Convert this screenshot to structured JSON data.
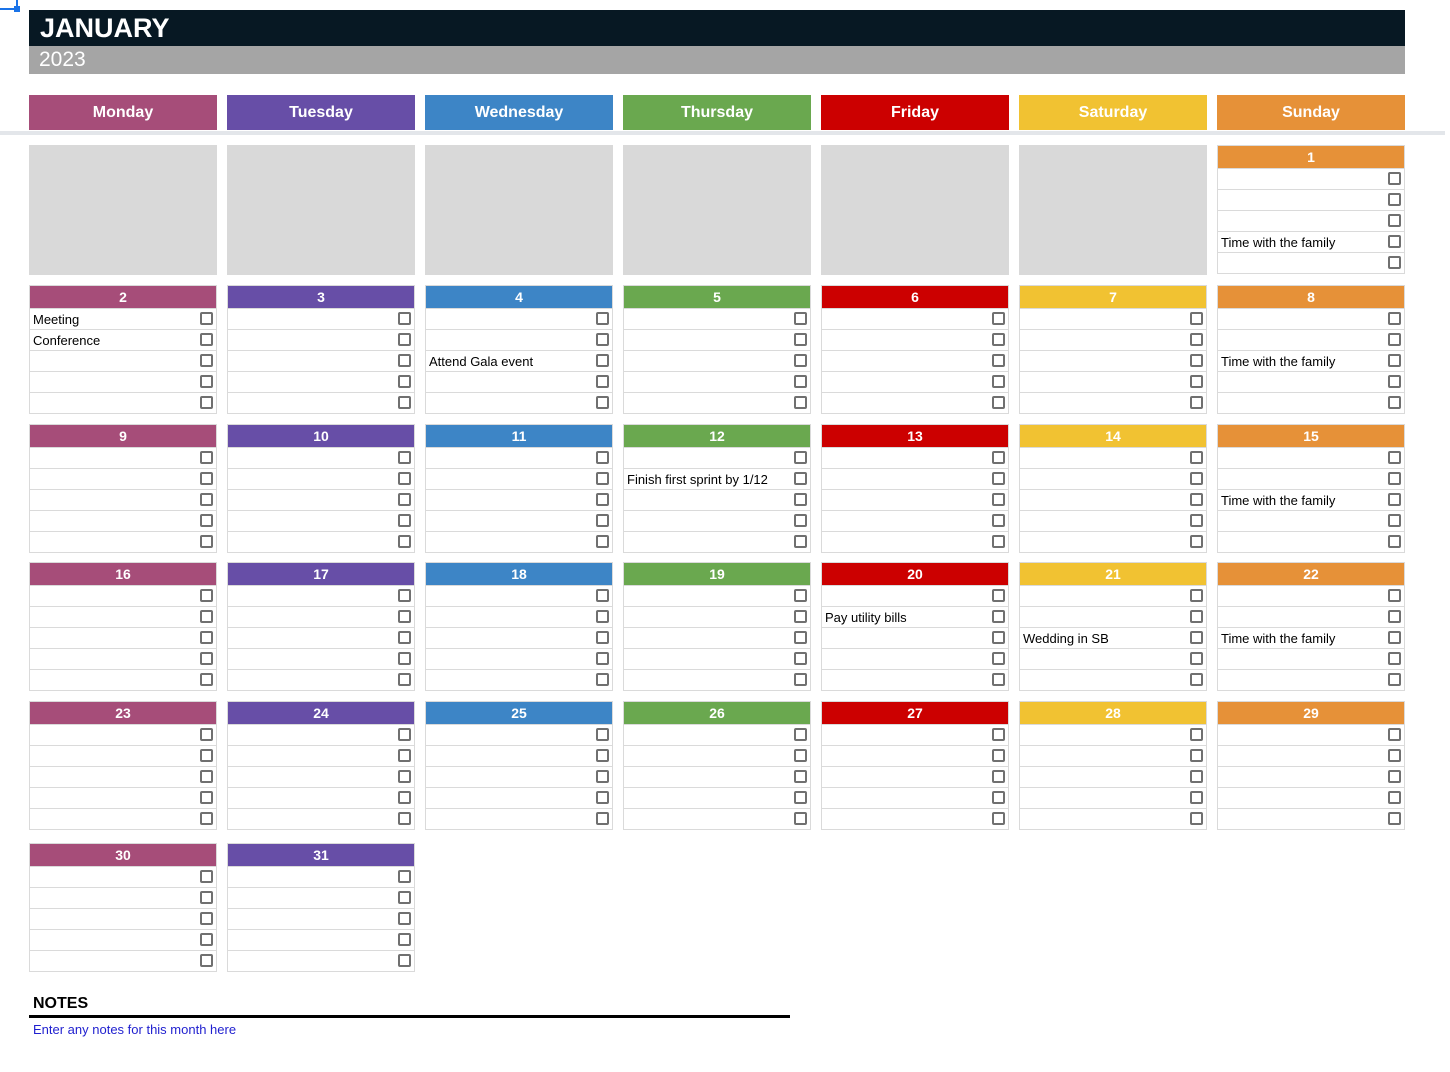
{
  "header": {
    "month": "JANUARY",
    "year": "2023"
  },
  "weekdays": [
    {
      "label": "Monday",
      "color": "#a64d79"
    },
    {
      "label": "Tuesday",
      "color": "#674ea7"
    },
    {
      "label": "Wednesday",
      "color": "#3d85c6"
    },
    {
      "label": "Thursday",
      "color": "#6aa84f"
    },
    {
      "label": "Friday",
      "color": "#cc0000"
    },
    {
      "label": "Saturday",
      "color": "#f1c232"
    },
    {
      "label": "Sunday",
      "color": "#e69138"
    }
  ],
  "weeks": [
    [
      null,
      null,
      null,
      null,
      null,
      null,
      {
        "day": "1",
        "tasks": [
          "",
          "",
          "",
          "Time with the family",
          ""
        ]
      }
    ],
    [
      {
        "day": "2",
        "tasks": [
          "Meeting",
          "Conference",
          "",
          "",
          ""
        ]
      },
      {
        "day": "3",
        "tasks": [
          "",
          "",
          "",
          "",
          ""
        ]
      },
      {
        "day": "4",
        "tasks": [
          "",
          "",
          "Attend Gala event",
          "",
          ""
        ]
      },
      {
        "day": "5",
        "tasks": [
          "",
          "",
          "",
          "",
          ""
        ]
      },
      {
        "day": "6",
        "tasks": [
          "",
          "",
          "",
          "",
          ""
        ]
      },
      {
        "day": "7",
        "tasks": [
          "",
          "",
          "",
          "",
          ""
        ]
      },
      {
        "day": "8",
        "tasks": [
          "",
          "",
          "Time with the family",
          "",
          ""
        ]
      }
    ],
    [
      {
        "day": "9",
        "tasks": [
          "",
          "",
          "",
          "",
          ""
        ]
      },
      {
        "day": "10",
        "tasks": [
          "",
          "",
          "",
          "",
          ""
        ]
      },
      {
        "day": "11",
        "tasks": [
          "",
          "",
          "",
          "",
          ""
        ]
      },
      {
        "day": "12",
        "tasks": [
          "",
          "Finish first sprint by 1/12",
          "",
          "",
          ""
        ]
      },
      {
        "day": "13",
        "tasks": [
          "",
          "",
          "",
          "",
          ""
        ]
      },
      {
        "day": "14",
        "tasks": [
          "",
          "",
          "",
          "",
          ""
        ]
      },
      {
        "day": "15",
        "tasks": [
          "",
          "",
          "Time with the family",
          "",
          ""
        ]
      }
    ],
    [
      {
        "day": "16",
        "tasks": [
          "",
          "",
          "",
          "",
          ""
        ]
      },
      {
        "day": "17",
        "tasks": [
          "",
          "",
          "",
          "",
          ""
        ]
      },
      {
        "day": "18",
        "tasks": [
          "",
          "",
          "",
          "",
          ""
        ]
      },
      {
        "day": "19",
        "tasks": [
          "",
          "",
          "",
          "",
          ""
        ]
      },
      {
        "day": "20",
        "tasks": [
          "",
          "Pay utility bills",
          "",
          "",
          ""
        ]
      },
      {
        "day": "21",
        "tasks": [
          "",
          "",
          "Wedding in SB",
          "",
          ""
        ]
      },
      {
        "day": "22",
        "tasks": [
          "",
          "",
          "Time with the family",
          "",
          ""
        ]
      }
    ],
    [
      {
        "day": "23",
        "tasks": [
          "",
          "",
          "",
          "",
          ""
        ]
      },
      {
        "day": "24",
        "tasks": [
          "",
          "",
          "",
          "",
          ""
        ]
      },
      {
        "day": "25",
        "tasks": [
          "",
          "",
          "",
          "",
          ""
        ]
      },
      {
        "day": "26",
        "tasks": [
          "",
          "",
          "",
          "",
          ""
        ]
      },
      {
        "day": "27",
        "tasks": [
          "",
          "",
          "",
          "",
          ""
        ]
      },
      {
        "day": "28",
        "tasks": [
          "",
          "",
          "",
          "",
          ""
        ]
      },
      {
        "day": "29",
        "tasks": [
          "",
          "",
          "",
          "",
          ""
        ]
      }
    ],
    [
      {
        "day": "30",
        "tasks": [
          "",
          "",
          "",
          "",
          ""
        ]
      },
      {
        "day": "31",
        "tasks": [
          "",
          "",
          "",
          "",
          ""
        ]
      }
    ]
  ],
  "notes": {
    "title": "NOTES",
    "placeholder": "Enter any notes for this month here"
  },
  "checkbox_icon": "empty-checkbox"
}
